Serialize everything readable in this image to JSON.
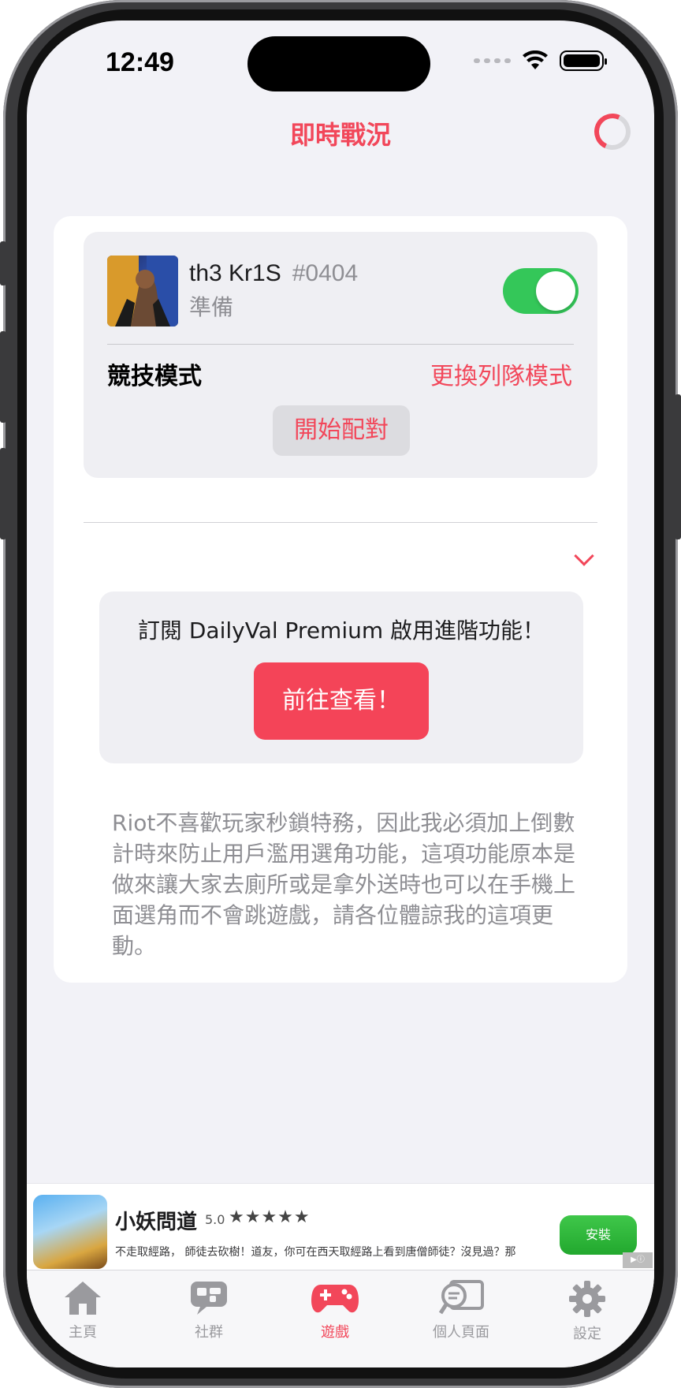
{
  "status_bar": {
    "time": "12:49"
  },
  "nav": {
    "title": "即時戰況"
  },
  "player": {
    "name": "th3 Kr1S",
    "tag": "#0404",
    "status": "準備",
    "ready_toggle_on": true
  },
  "queue": {
    "mode_label": "競技模式",
    "change_mode_label": "更換列隊模式",
    "start_match_label": "開始配對"
  },
  "premium": {
    "text": "訂閱 DailyVal Premium 啟用進階功能！",
    "button_label": "前往查看！"
  },
  "notice": "Riot不喜歡玩家秒鎖特務，因此我必須加上倒數計時來防止用戶濫用選角功能，這項功能原本是做來讓大家去廁所或是拿外送時也可以在手機上面選角而不會跳遊戲，請各位體諒我的這項更動。",
  "ad": {
    "title": "小妖問道",
    "rating": "5.0",
    "stars": "★★★★★",
    "description": "不走取經路， 師徒去砍樹！道友，你可在西天取經路上看到唐僧師徒？沒見過？那",
    "install_label": "安裝"
  },
  "tabbar": {
    "items": [
      {
        "label": "主頁",
        "icon": "home-icon"
      },
      {
        "label": "社群",
        "icon": "chat-bubbles-icon"
      },
      {
        "label": "遊戲",
        "icon": "gamepad-icon",
        "active": true
      },
      {
        "label": "個人頁面",
        "icon": "profile-search-icon"
      },
      {
        "label": "設定",
        "icon": "gear-icon"
      }
    ]
  },
  "colors": {
    "accent": "#f2475a",
    "toggle_on": "#34c759",
    "background": "#f2f2f7"
  }
}
